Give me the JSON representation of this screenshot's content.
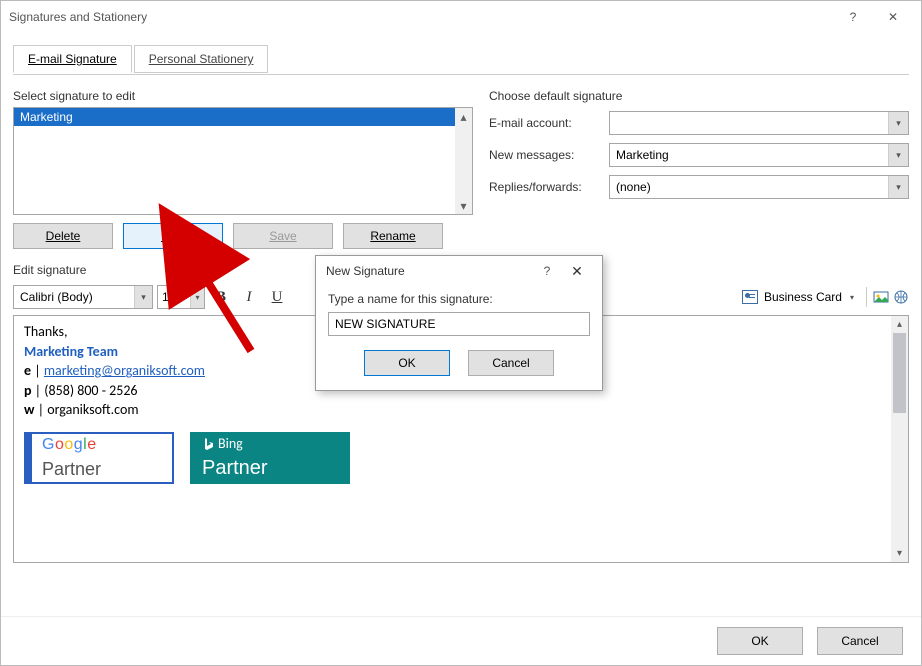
{
  "window": {
    "title": "Signatures and Stationery",
    "help": "?",
    "close": "✕"
  },
  "tabs": {
    "email_signature": "E-mail Signature",
    "personal_stationery": "Personal Stationery"
  },
  "left": {
    "select_label": "Select signature to edit",
    "signatures": [
      "Marketing"
    ],
    "buttons": {
      "delete": "Delete",
      "new": "New",
      "save": "Save",
      "rename": "Rename"
    }
  },
  "right": {
    "title": "Choose default signature",
    "email_account_label": "E-mail account:",
    "email_account_value": "",
    "new_messages_label": "New messages:",
    "new_messages_value": "Marketing",
    "replies_label": "Replies/forwards:",
    "replies_value": "(none)"
  },
  "edit": {
    "label": "Edit signature",
    "font": "Calibri (Body)",
    "size": "10",
    "b": "B",
    "i": "I",
    "u": "U",
    "business_card": "Business Card"
  },
  "signature": {
    "thanks": "Thanks,",
    "team": "Marketing Team",
    "e_label": "e",
    "email": "marketing@organiksoft.com",
    "p_label": "p",
    "phone": "(858) 800 - 2526",
    "w_label": "w",
    "web": "organiksoft.com",
    "google_partner": "Partner",
    "bing": "Bing",
    "bing_partner": "Partner"
  },
  "footer": {
    "ok": "OK",
    "cancel": "Cancel"
  },
  "modal": {
    "title": "New Signature",
    "help": "?",
    "close": "✕",
    "prompt": "Type a name for this signature:",
    "value": "NEW SIGNATURE",
    "ok": "OK",
    "cancel": "Cancel"
  }
}
